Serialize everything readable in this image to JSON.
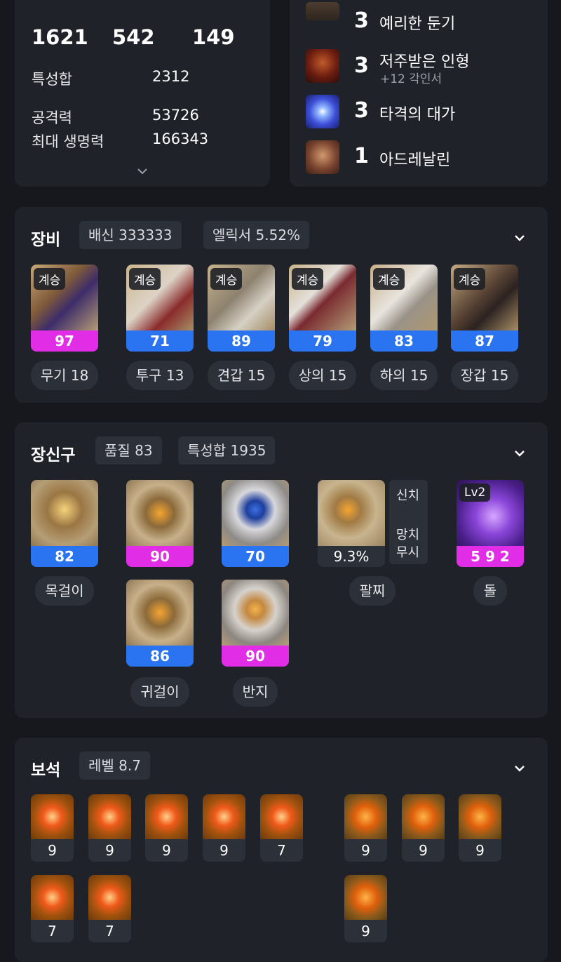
{
  "stats": {
    "top_values": [
      "1621",
      "542",
      "149"
    ],
    "rows": [
      {
        "label": "특성합",
        "value": "2312"
      },
      {
        "label": "공격력",
        "value": "53726"
      },
      {
        "label": "최대 생명력",
        "value": "166343"
      }
    ]
  },
  "engravings": [
    {
      "level": "3",
      "name": "예리한 둔기",
      "sub": ""
    },
    {
      "level": "3",
      "name": "저주받은 인형",
      "sub": "+12 각인서"
    },
    {
      "level": "3",
      "name": "타격의 대가",
      "sub": ""
    },
    {
      "level": "1",
      "name": "아드레날린",
      "sub": ""
    }
  ],
  "equipment": {
    "title": "장비",
    "chips": [
      "배신 333333",
      "엘릭서 5.52%"
    ],
    "items": [
      {
        "tag": "계승",
        "quality": "97",
        "label": "무기 18",
        "color": "#e12ee6"
      },
      {
        "tag": "계승",
        "quality": "71",
        "label": "투구 13",
        "color": "#2a73f1"
      },
      {
        "tag": "계승",
        "quality": "89",
        "label": "견갑 15",
        "color": "#2a73f1"
      },
      {
        "tag": "계승",
        "quality": "79",
        "label": "상의 15",
        "color": "#2a73f1"
      },
      {
        "tag": "계승",
        "quality": "83",
        "label": "하의 15",
        "color": "#2a73f1"
      },
      {
        "tag": "계승",
        "quality": "87",
        "label": "장갑 15",
        "color": "#2a73f1"
      }
    ]
  },
  "accessories": {
    "title": "장신구",
    "chips": [
      "품질 83",
      "특성합 1935"
    ],
    "necklace": {
      "quality": "82",
      "label": "목걸이"
    },
    "earrings": [
      {
        "quality": "90"
      },
      {
        "quality": "86"
      }
    ],
    "earring_label": "귀걸이",
    "rings": [
      {
        "quality": "70"
      },
      {
        "quality": "90"
      }
    ],
    "ring_label": "반지",
    "bracelet": {
      "value": "9.3%",
      "label": "팔찌",
      "effects": [
        "신치",
        "망치",
        "무시"
      ]
    },
    "stone": {
      "level": "Lv2",
      "value": "5 9 2",
      "label": "돌"
    }
  },
  "gems": {
    "title": "보석",
    "chips": [
      "레벨 8.7"
    ],
    "left_row1": [
      "9",
      "9",
      "9",
      "9",
      "7"
    ],
    "left_row2": [
      "7",
      "7"
    ],
    "right_row1": [
      "9",
      "9",
      "9"
    ],
    "right_row2": [
      "9"
    ]
  }
}
